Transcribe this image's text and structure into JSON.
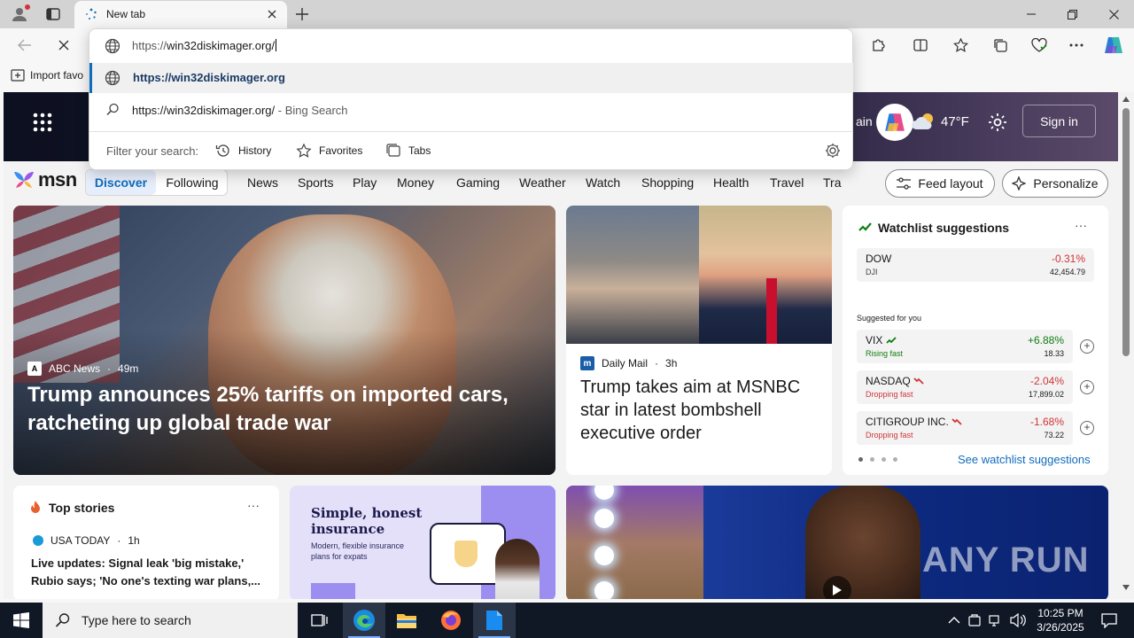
{
  "browser": {
    "tab_title": "New tab",
    "favorites_import": "Import favo",
    "address": {
      "prefix": "https://",
      "host": "win32diskimager.org/"
    }
  },
  "omnibox": {
    "suggestion_url": "https://win32diskimager.org",
    "search_query": "https://win32diskimager.org/",
    "search_suffix": " - Bing Search",
    "filter_label": "Filter your search:",
    "filters": [
      "History",
      "Favorites",
      "Tabs"
    ]
  },
  "msn": {
    "header_word": "ain",
    "temperature": "47°F",
    "sign_in": "Sign in",
    "logo": "msn",
    "nav_discover": "Discover",
    "nav_following": "Following",
    "categories": [
      "News",
      "Sports",
      "Play",
      "Money",
      "Gaming",
      "Weather",
      "Watch",
      "Shopping",
      "Health",
      "Travel",
      "Tra"
    ],
    "feed_layout": "Feed layout",
    "personalize": "Personalize"
  },
  "hero": {
    "source": "ABC News",
    "source_logo": "A",
    "time": "49m",
    "title": "Trump announces 25% tariffs on imported cars, ratcheting up global trade war"
  },
  "article2": {
    "source": "Daily Mail",
    "source_logo": "m",
    "time": "3h",
    "title": "Trump takes aim at MSNBC star in latest bombshell executive order"
  },
  "watchlist": {
    "title": "Watchlist suggestions",
    "more": "···",
    "suggested_label": "Suggested for you",
    "see_more": "See watchlist suggestions",
    "stocks": [
      {
        "symbol": "DOW",
        "sub": "DJI",
        "change": "-0.31%",
        "price": "42,454.79",
        "trend_color": "#d13438",
        "sub_color": "#444444"
      },
      {
        "symbol": "VIX",
        "sub": "Rising fast",
        "change": "+6.88%",
        "price": "18.33",
        "trend_color": "#107c10",
        "sub_color": "#107c10"
      },
      {
        "symbol": "NASDAQ",
        "sub": "Dropping fast",
        "change": "-2.04%",
        "price": "17,899.02",
        "trend_color": "#d13438",
        "sub_color": "#d13438"
      },
      {
        "symbol": "CITIGROUP INC.",
        "sub": "Dropping fast",
        "change": "-1.68%",
        "price": "73.22",
        "trend_color": "#d13438",
        "sub_color": "#d13438"
      }
    ]
  },
  "top_stories": {
    "title": "Top stories",
    "more": "···",
    "source": "USA TODAY",
    "time": "1h",
    "headline": "Live updates: Signal leak 'big mistake,' Rubio says; 'No one's texting war plans,..."
  },
  "ad": {
    "title": "Simple, honest insurance",
    "subtitle": "Modern, flexible insurance plans for expats"
  },
  "video": {
    "watermark": "ANY RUN"
  },
  "taskbar": {
    "search_placeholder": "Type here to search",
    "time": "10:25 PM",
    "date": "3/26/2025"
  },
  "colors": {
    "accent": "#0f6cbd",
    "positive": "#107c10",
    "negative": "#d13438"
  }
}
